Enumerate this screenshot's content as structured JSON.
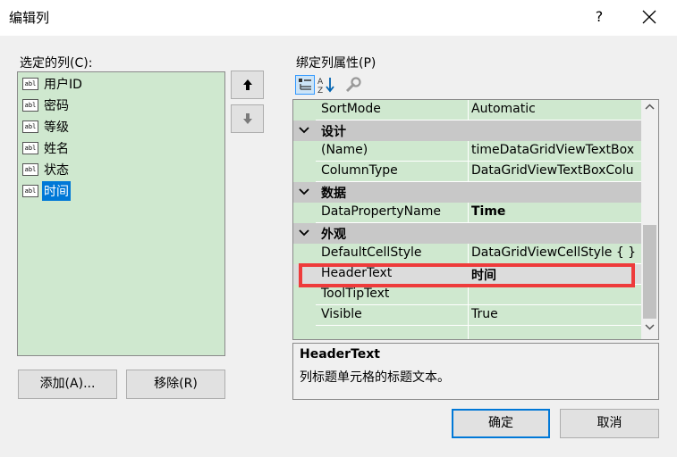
{
  "window": {
    "title": "编辑列",
    "help_label": "?"
  },
  "left": {
    "selected_columns_label": "选定的列(C):",
    "columns": [
      {
        "icon": "abl",
        "label": "用户ID",
        "selected": false
      },
      {
        "icon": "abl",
        "label": "密码",
        "selected": false
      },
      {
        "icon": "abl",
        "label": "等级",
        "selected": false
      },
      {
        "icon": "abl",
        "label": "姓名",
        "selected": false
      },
      {
        "icon": "abl",
        "label": "状态",
        "selected": false
      },
      {
        "icon": "abl",
        "label": "时间",
        "selected": true
      }
    ],
    "add_button": "添加(A)...",
    "remove_button": "移除(R)"
  },
  "right": {
    "properties_label": "绑定列属性(P)",
    "rows": [
      {
        "kind": "prop",
        "name": "SortMode",
        "value": "Automatic"
      },
      {
        "kind": "cat",
        "name": "设计"
      },
      {
        "kind": "prop",
        "name": "(Name)",
        "value": "timeDataGridViewTextBox"
      },
      {
        "kind": "prop",
        "name": "ColumnType",
        "value": "DataGridViewTextBoxColu"
      },
      {
        "kind": "cat",
        "name": "数据"
      },
      {
        "kind": "prop",
        "name": "DataPropertyName",
        "value": "Time",
        "bold": true
      },
      {
        "kind": "cat",
        "name": "外观"
      },
      {
        "kind": "prop",
        "name": "DefaultCellStyle",
        "value": "DataGridViewCellStyle { }"
      },
      {
        "kind": "prop",
        "name": "HeaderText",
        "value": "时间",
        "bold": true,
        "highlighted": true
      },
      {
        "kind": "prop",
        "name": "ToolTipText",
        "value": ""
      },
      {
        "kind": "prop",
        "name": "Visible",
        "value": "True"
      }
    ],
    "description": {
      "title": "HeaderText",
      "text": "列标题单元格的标题文本。"
    }
  },
  "footer": {
    "ok": "确定",
    "cancel": "取消"
  },
  "colors": {
    "list_bg": "#cfe8cf",
    "selection": "#0078d7",
    "highlight_box": "#ee3b3b",
    "category_bg": "#c8c8c8"
  }
}
